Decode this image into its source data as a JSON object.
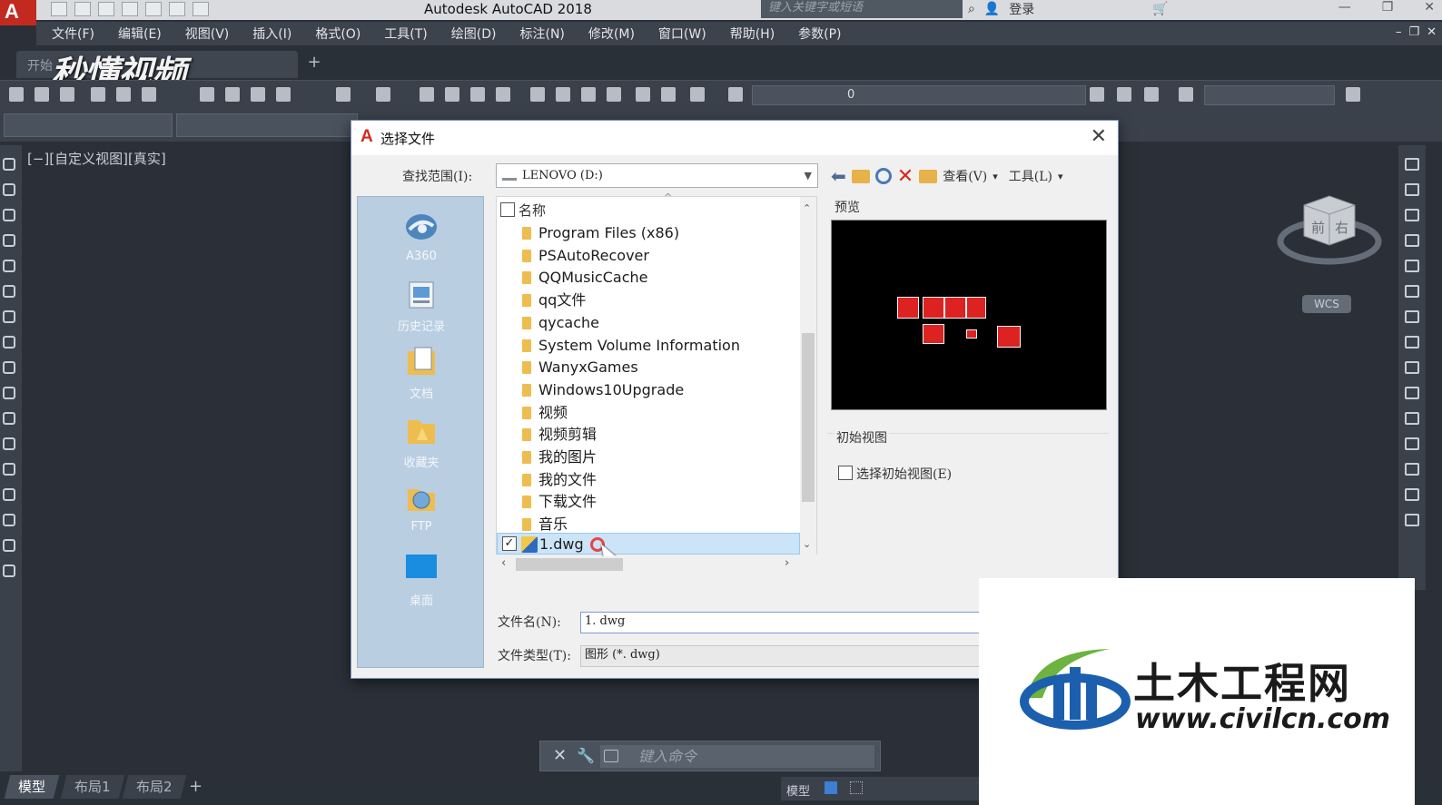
{
  "app": {
    "logo_letter": "A",
    "title": "Autodesk AutoCAD 2018",
    "search_placeholder": "键入关键字或短语",
    "login": "登录"
  },
  "menu": [
    "文件(F)",
    "编辑(E)",
    "视图(V)",
    "插入(I)",
    "格式(O)",
    "工具(T)",
    "绘图(D)",
    "标注(N)",
    "修改(M)",
    "窗口(W)",
    "帮助(H)",
    "参数(P)"
  ],
  "tabs": {
    "start": "开始"
  },
  "watermark_top": "秒懂视频",
  "layer": {
    "value": "0"
  },
  "viewport": {
    "label": "[−][自定义视图][真实]",
    "cube_face_1": "前",
    "cube_face_2": "右",
    "wcs": "WCS"
  },
  "command": {
    "placeholder": "键入命令"
  },
  "layout_tabs": [
    "模型",
    "布局1",
    "布局2"
  ],
  "statusbar": {
    "model": "模型"
  },
  "dialog": {
    "title": "选择文件",
    "lookin_label": "查找范围(I):",
    "lookin_value": "LENOVO (D:)",
    "tools": {
      "views": "查看(V)",
      "tools": "工具(L)"
    },
    "places": [
      "A360",
      "历史记录",
      "文档",
      "收藏夹",
      "FTP",
      "桌面"
    ],
    "list_header": "名称",
    "files": [
      "Program Files (x86)",
      "PSAutoRecover",
      "QQMusicCache",
      "qq文件",
      "qycache",
      "System Volume Information",
      "WanyxGames",
      "Windows10Upgrade",
      "视频",
      "视频剪辑",
      "我的图片",
      "我的文件",
      "下载文件",
      "音乐"
    ],
    "selected_file": "1.dwg",
    "preview_label": "预览",
    "initial_view_group": "初始视图",
    "initial_view_checkbox": "选择初始视图(E)",
    "filename_label": "文件名(N):",
    "filename_value": "1. dwg",
    "filetype_label": "文件类型(T):",
    "filetype_value": "图形 (*. dwg)"
  },
  "watermark_br": {
    "cn": "土木工程网",
    "url": "www.civilcn.com"
  },
  "colors": {
    "accent_red": "#c22a20",
    "selection": "#cce4f7",
    "watermark_blue": "#1c5fae",
    "watermark_green": "#6cb33f"
  }
}
